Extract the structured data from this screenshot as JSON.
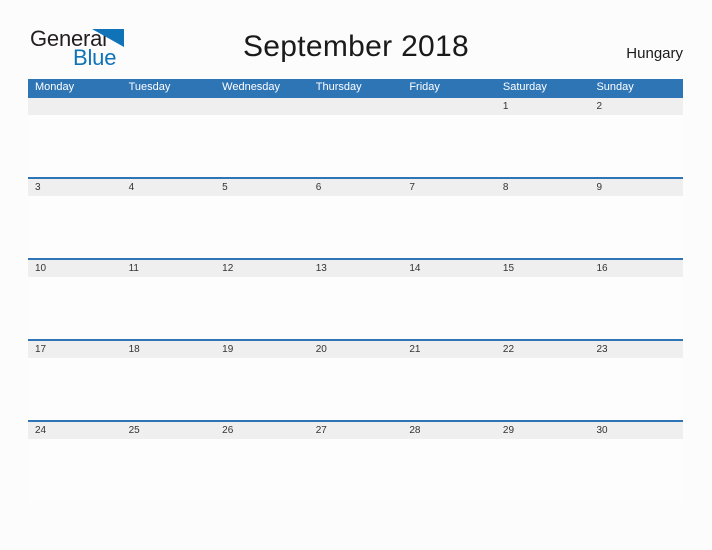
{
  "brand": {
    "name_part1": "General",
    "name_part2": "Blue",
    "flag_icon": "blue-triangle-flag-icon",
    "accent_color": "#1073b8"
  },
  "header": {
    "title": "September 2018",
    "country": "Hungary"
  },
  "calendar": {
    "header_bg": "#2e75b6",
    "date_band_bg": "#efefef",
    "weekdays": [
      "Monday",
      "Tuesday",
      "Wednesday",
      "Thursday",
      "Friday",
      "Saturday",
      "Sunday"
    ],
    "weeks": [
      [
        "",
        "",
        "",
        "",
        "",
        "1",
        "2"
      ],
      [
        "3",
        "4",
        "5",
        "6",
        "7",
        "8",
        "9"
      ],
      [
        "10",
        "11",
        "12",
        "13",
        "14",
        "15",
        "16"
      ],
      [
        "17",
        "18",
        "19",
        "20",
        "21",
        "22",
        "23"
      ],
      [
        "24",
        "25",
        "26",
        "27",
        "28",
        "29",
        "30"
      ]
    ]
  }
}
